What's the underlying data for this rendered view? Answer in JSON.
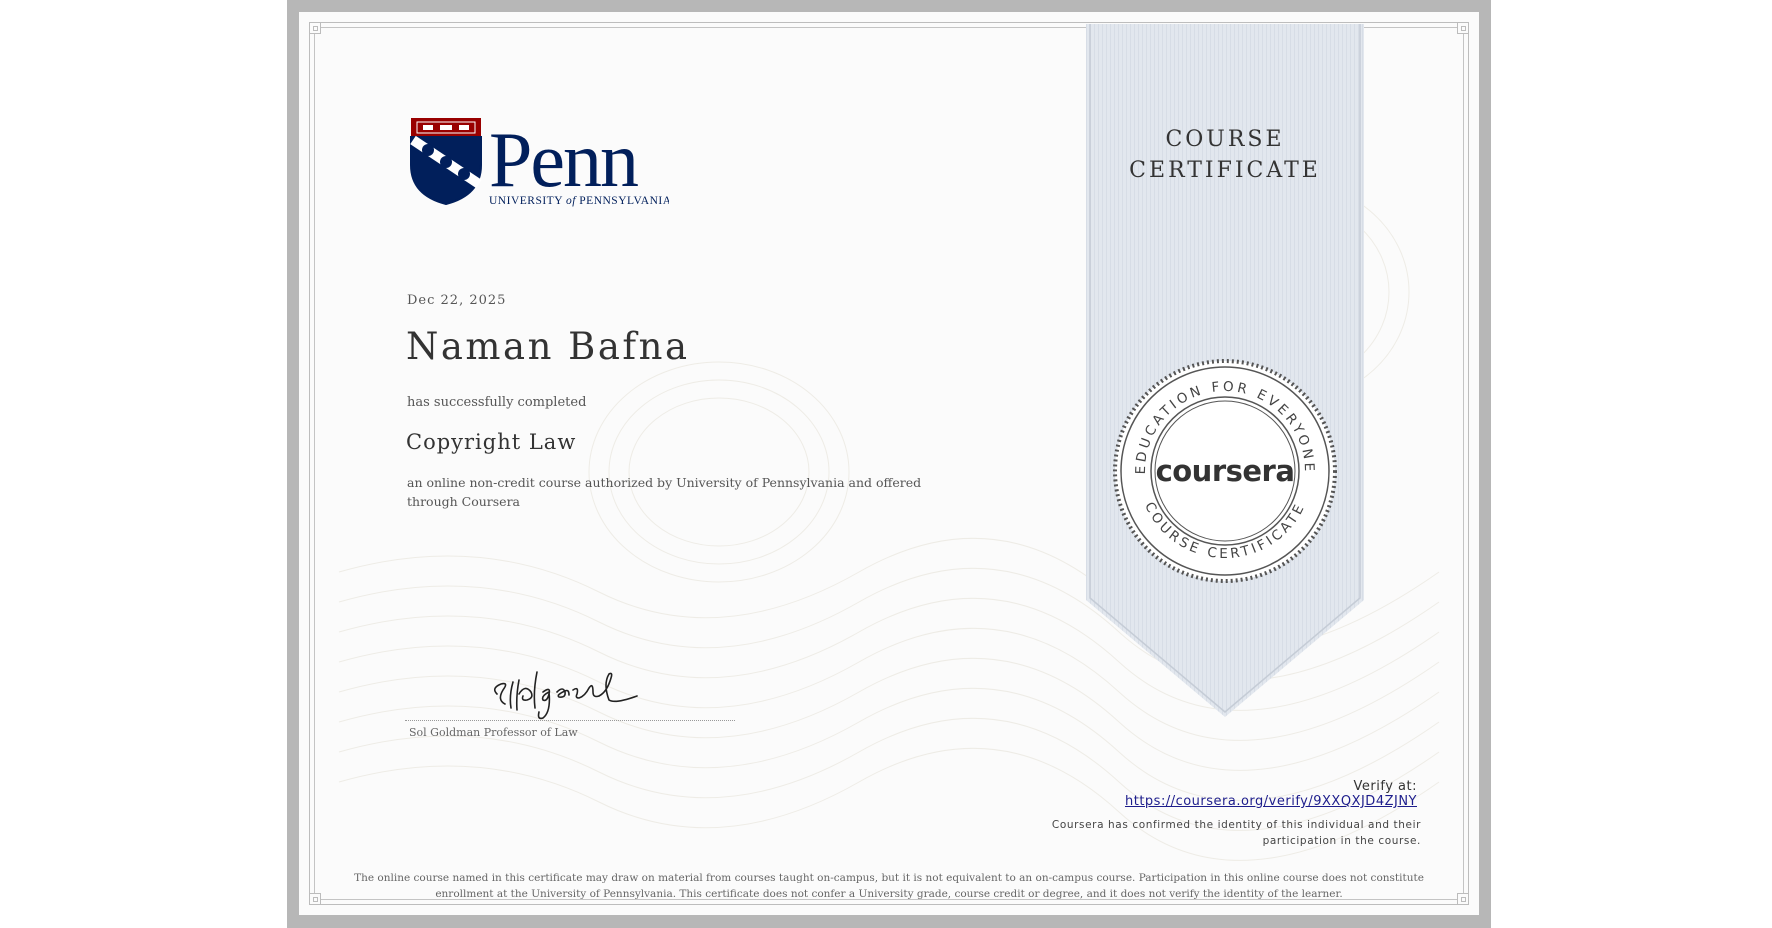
{
  "colors": {
    "penn_navy": "#011f5b",
    "penn_red": "#990000",
    "ribbon": "#e2e7ee",
    "link": "#1d1d8c"
  },
  "logo": {
    "wordmark": "Penn",
    "subtitle_pre": "University",
    "subtitle_of": "of",
    "subtitle_post": "Pennsylvania",
    "icon": "penn-shield-icon"
  },
  "certificate": {
    "date": "Dec 22, 2025",
    "recipient": "Naman Bafna",
    "completed_text": "has successfully completed",
    "course_name": "Copyright Law",
    "description": "an online non-credit course authorized by University of Pennsylvania and offered through Coursera"
  },
  "signature": {
    "title": "Sol Goldman Professor of Law",
    "icon": "handwritten-signature"
  },
  "ribbon": {
    "line1": "COURSE",
    "line2": "CERTIFICATE"
  },
  "seal": {
    "top_text": "EDUCATION FOR EVERYONE",
    "bottom_text": "COURSE CERTIFICATE",
    "center": "coursera"
  },
  "verify": {
    "label": "Verify at:",
    "url": "https://coursera.org/verify/9XXQXJD4ZJNY",
    "confirm": "Coursera has confirmed the identity of this individual and their participation in the course."
  },
  "disclaimer": "The online course named in this certificate may draw on material from courses taught on-campus, but it is not equivalent to an on-campus course. Participation in this online course does not constitute enrollment at the University of Pennsylvania. This certificate does not confer a University grade, course credit or degree, and it does not verify the identity of the learner."
}
